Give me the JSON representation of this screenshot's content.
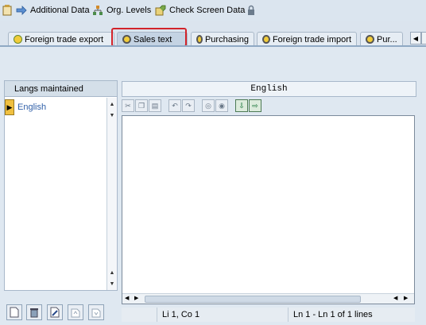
{
  "toolbar": {
    "items": [
      {
        "label": "Additional Data"
      },
      {
        "label": "Org. Levels"
      },
      {
        "label": "Check Screen Data"
      }
    ]
  },
  "tabs": [
    {
      "label": "Foreign trade export"
    },
    {
      "label": "Sales text"
    },
    {
      "label": "Purchasing"
    },
    {
      "label": "Foreign trade import"
    },
    {
      "label": "Pur..."
    }
  ],
  "active_tab": "Sales text",
  "languages": {
    "header": "Langs maintained",
    "items": [
      "English"
    ]
  },
  "editor": {
    "language": "English",
    "content": ""
  },
  "status": {
    "position": "Li 1, Co 1",
    "lines": "Ln 1 - Ln 1 of 1 lines"
  },
  "colors": {
    "accent_red": "#d2232a",
    "link_blue": "#2f5fa8",
    "row_marker": "#f0c040"
  }
}
